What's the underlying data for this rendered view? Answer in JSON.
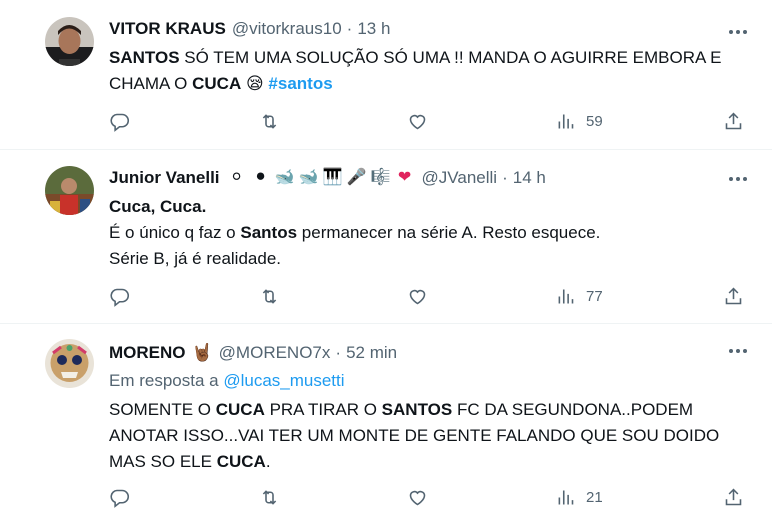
{
  "tweets": [
    {
      "name": "VITOR KRAUS",
      "handle": "@vitorkraus10",
      "time": "13 h",
      "views": "59",
      "text_parts": {
        "p1": "SANTOS",
        "p2": " SÓ TEM UMA SOLUÇÃO SÓ UMA !! MANDA O AGUIRRE EMBORA E CHAMA O ",
        "p3": "CUCA",
        "p4": " 😪 ",
        "p5": "#santos"
      }
    },
    {
      "name": "Junior Vanelli",
      "emojis": [
        "⚪",
        "⚫",
        "🐋",
        "🐋",
        "🎹",
        "🎤",
        "🎼",
        "❤"
      ],
      "handle": "@JVanelli",
      "time": "14 h",
      "views": "77",
      "line1": "Cuca, Cuca.",
      "line2_a": "É o único q faz o ",
      "line2_b": "Santos",
      "line2_c": " permanecer na série A. Resto esquece.",
      "line3": "Série B, já é realidade."
    },
    {
      "name": "MORENO",
      "badge": "🤘🏾",
      "handle": "@MORENO7x",
      "time": "52 min",
      "views": "21",
      "reply_prefix": "Em resposta a ",
      "reply_to": "@lucas_musetti",
      "text_parts": {
        "p1": "SOMENTE O ",
        "p2": "CUCA",
        "p3": " PRA TIRAR O ",
        "p4": "SANTOS",
        "p5": " FC DA SEGUNDONA..PODEM ANOTAR ISSO...VAI TER UM MONTE DE GENTE FALANDO QUE SOU DOIDO MAS SO ELE ",
        "p6": "CUCA",
        "p7": "."
      }
    }
  ],
  "separator": "·",
  "colors": {
    "text": "#0f1419",
    "secondary": "#536471",
    "link": "#1d9bf0",
    "border": "#eff3f4"
  },
  "icons": [
    "reply-icon",
    "retweet-icon",
    "like-icon",
    "views-icon",
    "share-icon",
    "more-icon"
  ]
}
